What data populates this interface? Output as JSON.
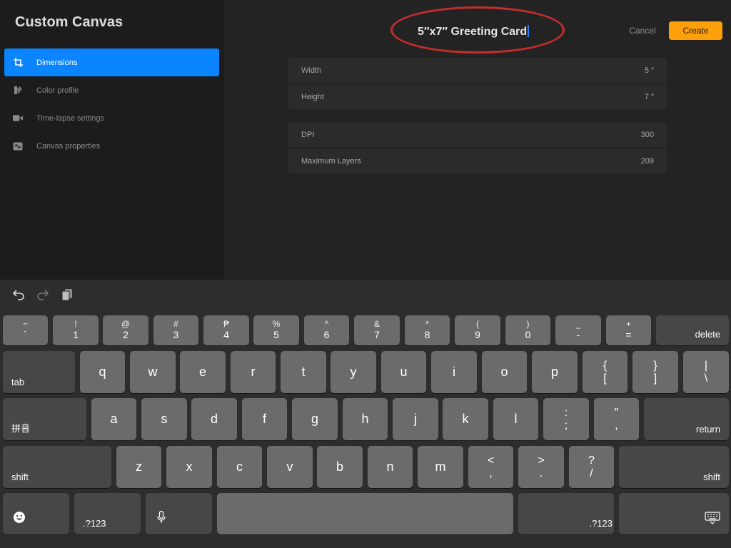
{
  "sidebar": {
    "title": "Custom Canvas",
    "items": [
      {
        "label": "Dimensions",
        "icon": "dimensions-icon",
        "active": true
      },
      {
        "label": "Color profile",
        "icon": "color-profile-icon",
        "active": false
      },
      {
        "label": "Time-lapse settings",
        "icon": "video-camera-icon",
        "active": false
      },
      {
        "label": "Canvas properties",
        "icon": "canvas-properties-icon",
        "active": false
      }
    ]
  },
  "header": {
    "canvas_name": "5″x7″ Greeting Card",
    "cancel_label": "Cancel",
    "create_label": "Create"
  },
  "settings": {
    "dimensions": [
      {
        "label": "Width",
        "value": "5 ″"
      },
      {
        "label": "Height",
        "value": "7 ″"
      }
    ],
    "other": [
      {
        "label": "DPI",
        "value": "300"
      },
      {
        "label": "Maximum Layers",
        "value": "209"
      }
    ]
  },
  "keyboard": {
    "toolbar": [
      "undo-icon",
      "redo-icon",
      "paste-icon"
    ],
    "number_row": [
      {
        "top": "~",
        "bottom": "`"
      },
      {
        "top": "!",
        "bottom": "1"
      },
      {
        "top": "@",
        "bottom": "2"
      },
      {
        "top": "#",
        "bottom": "3"
      },
      {
        "top": "₱",
        "bottom": "4"
      },
      {
        "top": "%",
        "bottom": "5"
      },
      {
        "top": "^",
        "bottom": "6"
      },
      {
        "top": "&",
        "bottom": "7"
      },
      {
        "top": "*",
        "bottom": "8"
      },
      {
        "top": "(",
        "bottom": "9"
      },
      {
        "top": ")",
        "bottom": "0"
      },
      {
        "top": "_",
        "bottom": "-"
      },
      {
        "top": "+",
        "bottom": "="
      }
    ],
    "delete_label": "delete",
    "tab_label": "tab",
    "row_q": [
      "q",
      "w",
      "e",
      "r",
      "t",
      "y",
      "u",
      "i",
      "o",
      "p"
    ],
    "bracket_keys": [
      {
        "top": "{",
        "bottom": "["
      },
      {
        "top": "}",
        "bottom": "]"
      },
      {
        "top": "|",
        "bottom": "\\"
      }
    ],
    "pinyin_label": "拼音",
    "row_a": [
      "a",
      "s",
      "d",
      "f",
      "g",
      "h",
      "j",
      "k",
      "l"
    ],
    "punct_a": [
      {
        "top": ":",
        "bottom": ";"
      },
      {
        "top": "″",
        "bottom": ","
      }
    ],
    "return_label": "return",
    "shift_label": "shift",
    "row_z": [
      "z",
      "x",
      "c",
      "v",
      "b",
      "n",
      "m"
    ],
    "punct_z": [
      {
        "top": "<",
        "bottom": ","
      },
      {
        "top": ">",
        "bottom": "."
      },
      {
        "top": "?",
        "bottom": "/"
      }
    ],
    "numbers_label": ".?123"
  }
}
